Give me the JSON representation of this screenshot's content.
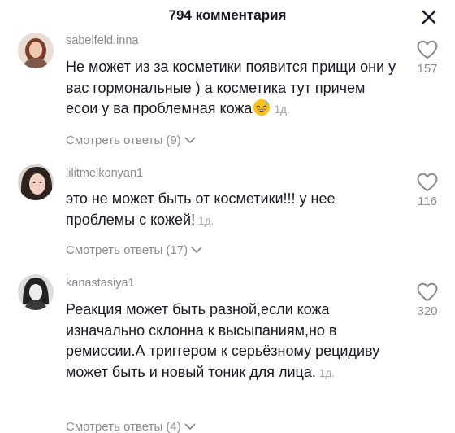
{
  "header": {
    "title": "794 комментария",
    "close_icon": "close-icon"
  },
  "comments": [
    {
      "username": "sabelfeld.inna",
      "text": "Не может из за косметики появится прищи они у вас гормональные ) а косметика тут причем есои у ва проблемная кожа",
      "emoji": "grinning-face-with-sweat",
      "time": "1д.",
      "replies_label": "Смотреть ответы (9)",
      "likes": "157"
    },
    {
      "username": "lilitmelkonyan1",
      "text": "это не может быть от косметики!!! у нее проблемы с кожей!",
      "time": "1д.",
      "replies_label": "Смотреть ответы (17)",
      "likes": "116"
    },
    {
      "username": "kanastasiya1",
      "text": "Реакция может быть разной,если кожа изначально склонна к высыпаниям,но в ремиссии.А триггером к серьёзному рецидиву может быть и новый тоник для лица.",
      "time": "1д.",
      "replies_label": "Смотреть ответы (4)",
      "likes": "320"
    }
  ]
}
